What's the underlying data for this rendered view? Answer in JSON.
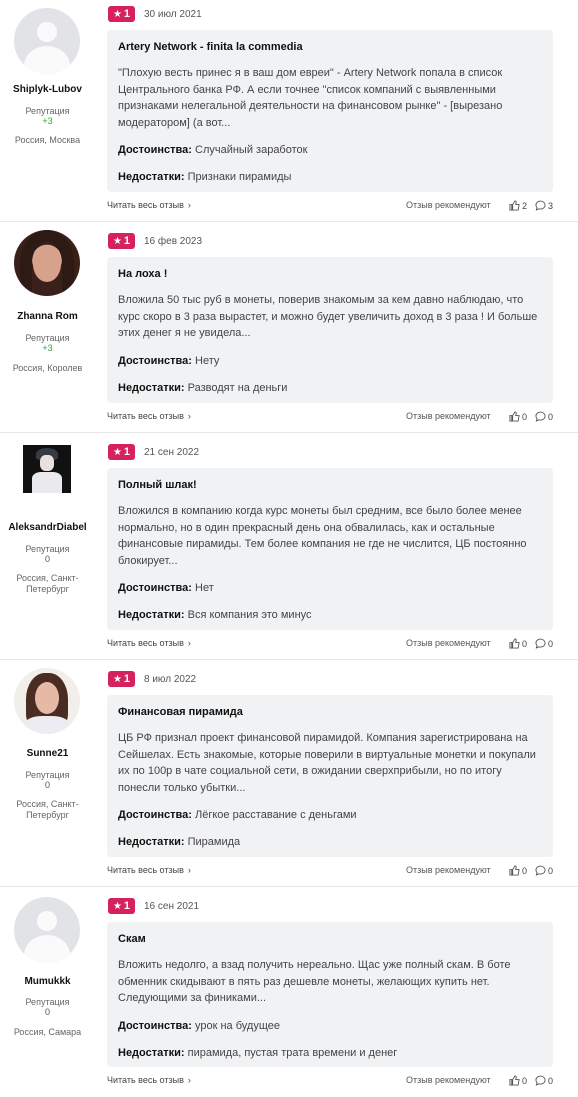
{
  "reviews": [
    {
      "author": {
        "name": "Shiplyk-Lubov",
        "reputation_label": "Репутация",
        "reputation": "+3",
        "location": "Россия, Москва",
        "avatar_icon": "default-avatar-icon"
      },
      "rating": "1",
      "date": "30 июл 2021",
      "title": "Artery Network - finita la commedia",
      "text": "\"Плохую весть принес я в ваш дом евреи\" - Artery Network попала в список Центрального банка РФ. А если точнее \"список компаний с выявленными признаками нелегальной деятельности на финансовом рынке\" - [вырезано модератором] (а вот...",
      "pros_label": "Достоинства:",
      "pros": "Случайный заработок",
      "cons_label": "Недостатки:",
      "cons": "Признаки пирамиды",
      "read_more": "Читать весь отзыв",
      "recommend": "Отзыв рекомендуют",
      "likes": "2",
      "comments": "3"
    },
    {
      "author": {
        "name": "Zhanna Rom",
        "reputation_label": "Репутация",
        "reputation": "+3",
        "location": "Россия, Королев",
        "avatar_icon": "user-photo-icon"
      },
      "rating": "1",
      "date": "16 фев 2023",
      "title": "На лоха !",
      "text": "Вложила 50 тыс руб в монеты, поверив знакомым за кем давно наблюдаю, что курс скоро в 3 раза вырастет, и можно будет увеличить доход в 3 раза ! И больше этих денег я не увидела...",
      "pros_label": "Достоинства:",
      "pros": "Нету",
      "cons_label": "Недостатки:",
      "cons": "Разводят на деньги",
      "read_more": "Читать весь отзыв",
      "recommend": "Отзыв рекомендуют",
      "likes": "0",
      "comments": "0"
    },
    {
      "author": {
        "name": "AleksandrDiabel",
        "reputation_label": "Репутация",
        "reputation": "0",
        "location": "Россия, Санкт-Петербург",
        "avatar_icon": "user-photo-icon"
      },
      "rating": "1",
      "date": "21 сен 2022",
      "title": "Полный шлак!",
      "text": "Вложился в компанию когда курс монеты был средним, все было более менее нормально, но в один прекрасный день она обвалилась, как и остальные финансовые пирамиды. Тем более компания не где не числится, ЦБ постоянно блокирует...",
      "pros_label": "Достоинства:",
      "pros": "Нет",
      "cons_label": "Недостатки:",
      "cons": "Вся компания это минус",
      "read_more": "Читать весь отзыв",
      "recommend": "Отзыв рекомендуют",
      "likes": "0",
      "comments": "0"
    },
    {
      "author": {
        "name": "Sunne21",
        "reputation_label": "Репутация",
        "reputation": "0",
        "location": "Россия, Санкт-Петербург",
        "avatar_icon": "user-photo-icon"
      },
      "rating": "1",
      "date": "8 июл 2022",
      "title": "Финансовая пирамида",
      "text": "ЦБ РФ признал проект финансовой пирамидой. Компания зарегистрирована на Сейшелах. Есть знакомые, которые поверили в виртуальные монетки и покупали их по 100р в чате социальной сети, в ожидании сверхприбыли, но по итогу понесли только убытки...",
      "pros_label": "Достоинства:",
      "pros": "Лёгкое расставание с деньгами",
      "cons_label": "Недостатки:",
      "cons": "Пирамида",
      "read_more": "Читать весь отзыв",
      "recommend": "Отзыв рекомендуют",
      "likes": "0",
      "comments": "0"
    },
    {
      "author": {
        "name": "Mumukkk",
        "reputation_label": "Репутация",
        "reputation": "0",
        "location": "Россия, Самара",
        "avatar_icon": "default-avatar-icon"
      },
      "rating": "1",
      "date": "16 сен 2021",
      "title": "Скам",
      "text": "Вложить недолго, а взад получить нереально. Щас уже полный скам. В боте обменник скидывают в пять раз дешевле монеты, желающих купить нет. Следующими за финиками...",
      "pros_label": "Достоинства:",
      "pros": "урок на будущее",
      "cons_label": "Недостатки:",
      "cons": "пирамида, пустая трата времени и денег",
      "read_more": "Читать весь отзыв",
      "recommend": "Отзыв рекомендуют",
      "likes": "0",
      "comments": "0"
    }
  ],
  "colors": {
    "accent": "#d5215d",
    "card_bg": "#f1f2f4",
    "positive": "#2ba63b"
  }
}
